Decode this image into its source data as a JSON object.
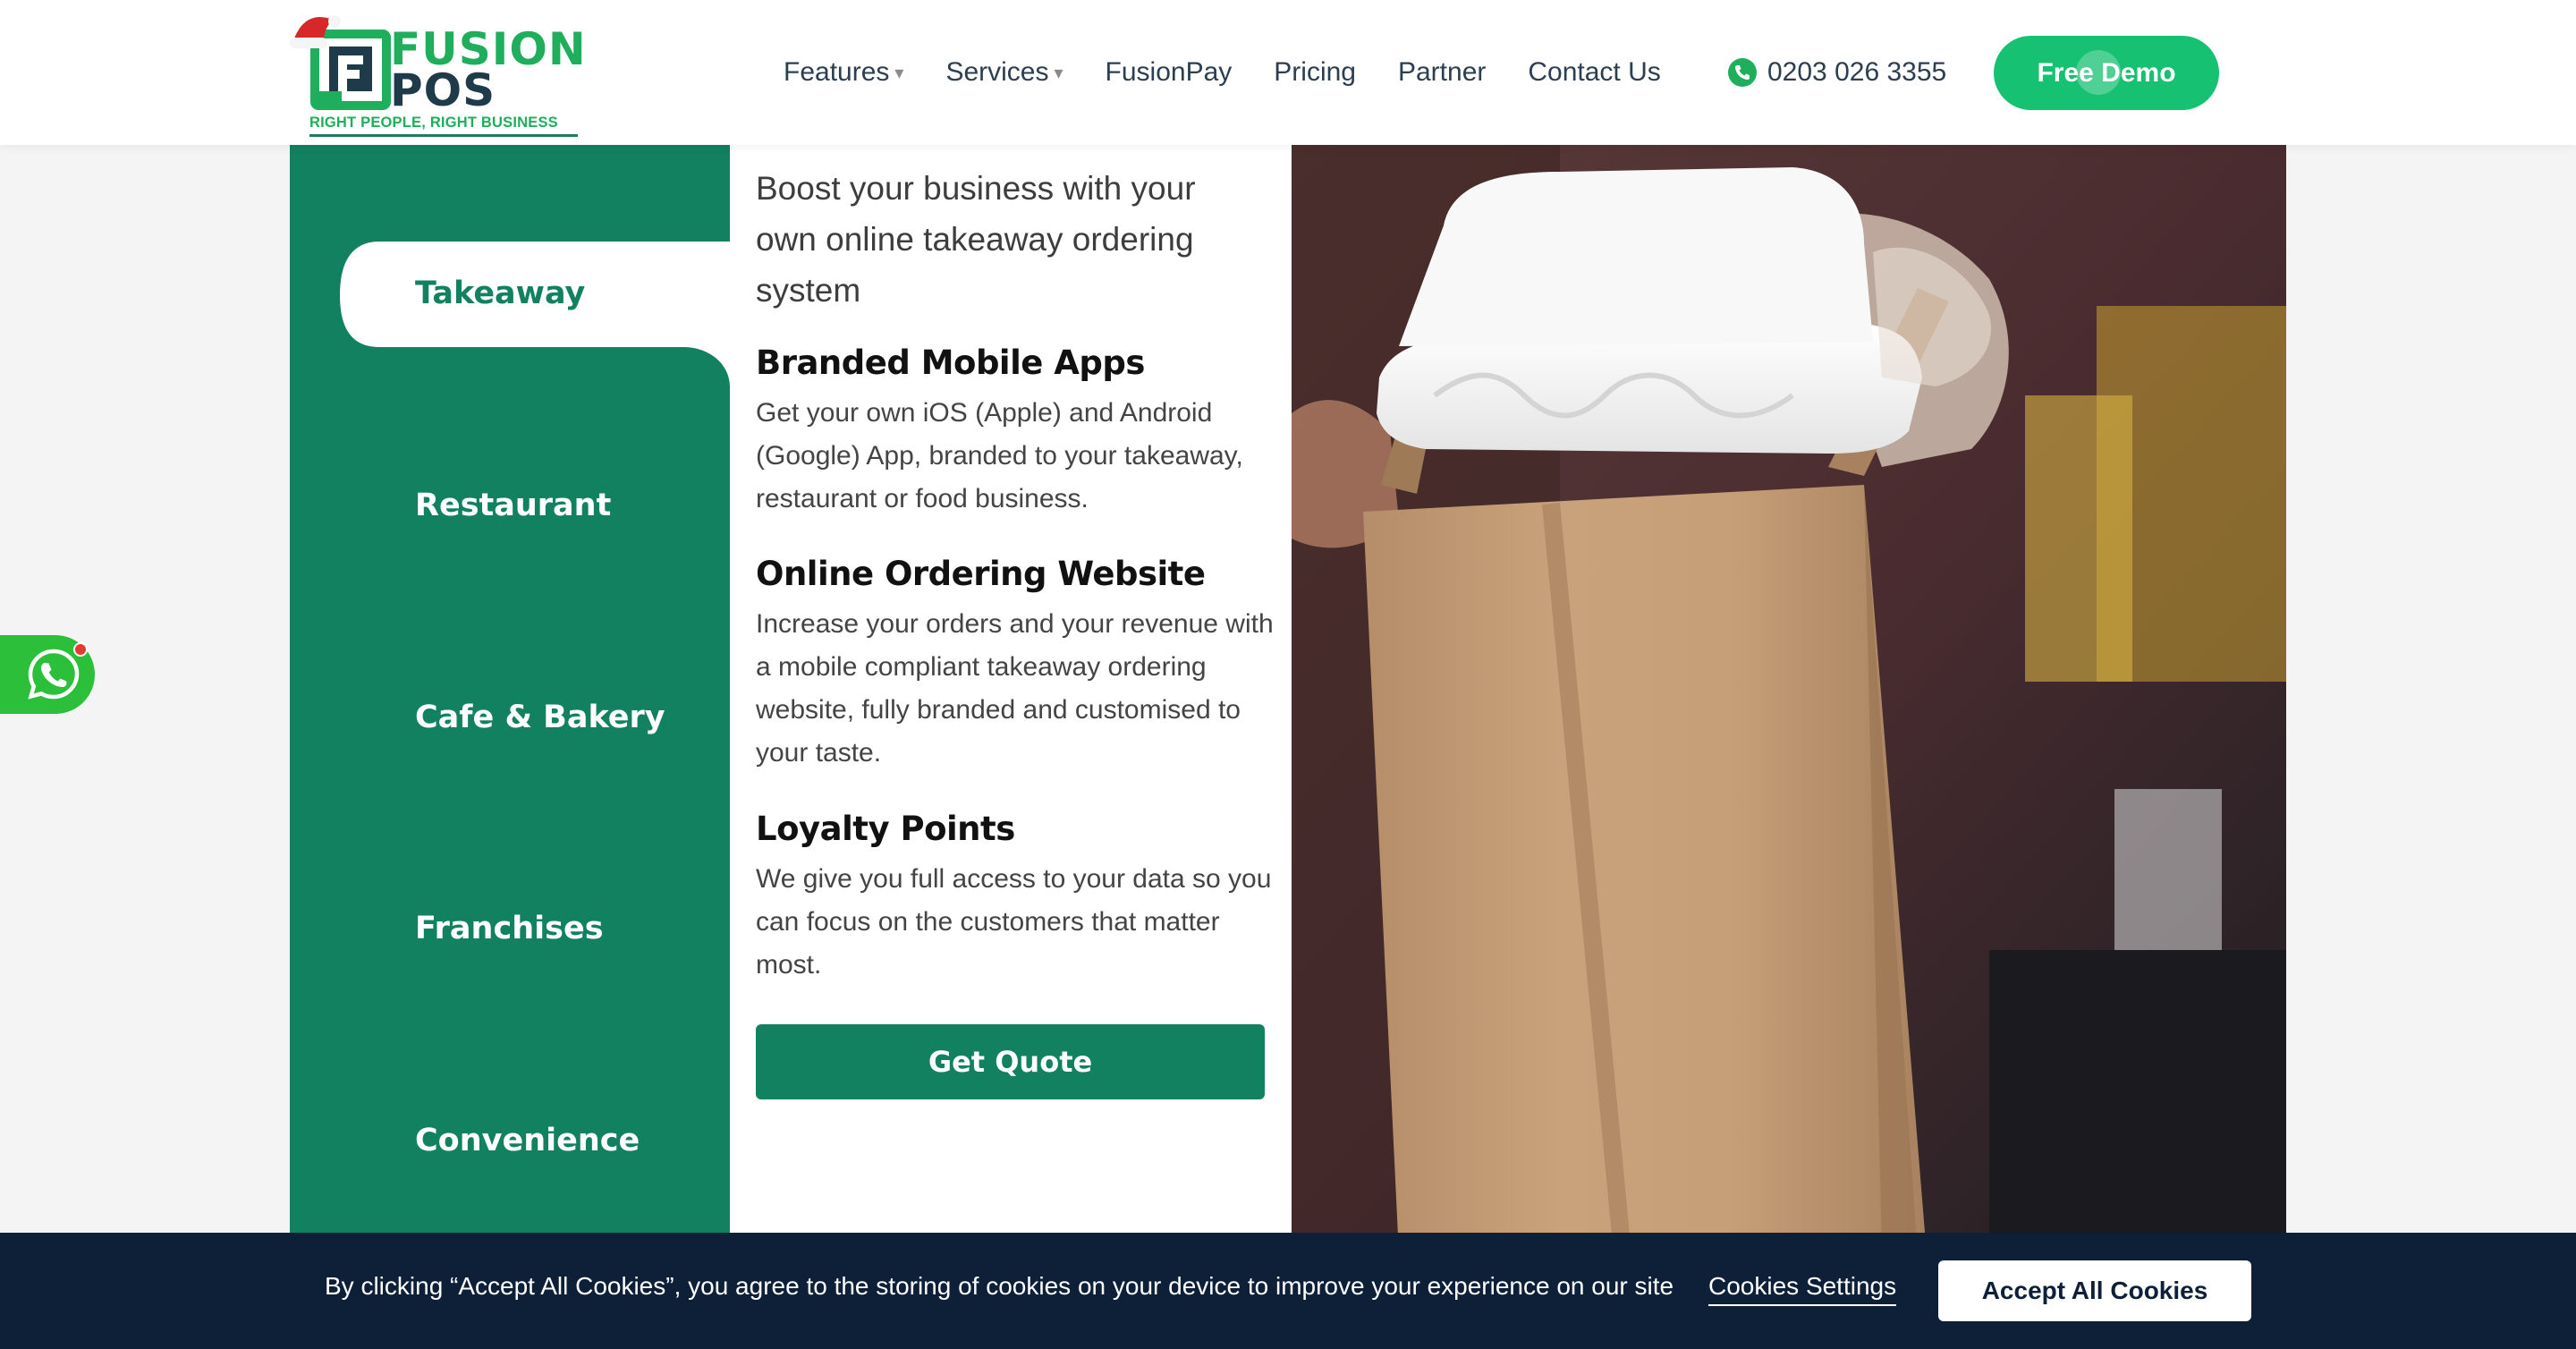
{
  "header": {
    "logo": {
      "brand_line1": "FUSION",
      "brand_line2": "POS",
      "tagline": "RIGHT PEOPLE, RIGHT BUSINESS"
    },
    "nav": [
      {
        "label": "Features",
        "has_dropdown": true
      },
      {
        "label": "Services",
        "has_dropdown": true
      },
      {
        "label": "FusionPay",
        "has_dropdown": false
      },
      {
        "label": "Pricing",
        "has_dropdown": false
      },
      {
        "label": "Partner",
        "has_dropdown": false
      },
      {
        "label": "Contact Us",
        "has_dropdown": false
      }
    ],
    "phone": "0203 026 3355",
    "demo_label": "Free Demo",
    "caret": "▾"
  },
  "tabs": [
    {
      "label": "Takeaway",
      "active": true
    },
    {
      "label": "Restaurant",
      "active": false
    },
    {
      "label": "Cafe & Bakery",
      "active": false
    },
    {
      "label": "Franchises",
      "active": false
    },
    {
      "label": "Convenience",
      "active": false
    }
  ],
  "content": {
    "intro": "Boost your business with your own online takeaway ordering system",
    "features": [
      {
        "title": "Branded Mobile Apps",
        "text": "Get your own iOS (Apple) and Android (Google) App, branded to your takeaway, restaurant or food business."
      },
      {
        "title": "Online Ordering Website",
        "text": "Increase your orders and your revenue with a mobile compliant takeaway ordering website, fully branded and customised to your taste."
      },
      {
        "title": "Loyalty Points",
        "text": "We give you full access to your data so you can focus on the customers that matter most."
      }
    ],
    "cta_label": "Get Quote"
  },
  "cookie_bar": {
    "text": "By clicking “Accept All Cookies”, you agree to the storing of cookies on your device to improve your experience on our site",
    "settings_label": "Cookies Settings",
    "accept_label": "Accept All Cookies"
  },
  "icons": {
    "phone": "phone-icon",
    "whatsapp": "whatsapp-icon",
    "logo": "fusion-pos-logo-icon",
    "hat": "santa-hat-icon"
  },
  "colors": {
    "brand_green": "#1fae5b",
    "tab_green": "#12815f",
    "demo_green": "#16c172",
    "navy": "#0e2038",
    "whatsapp_green": "#2cbf3a"
  }
}
